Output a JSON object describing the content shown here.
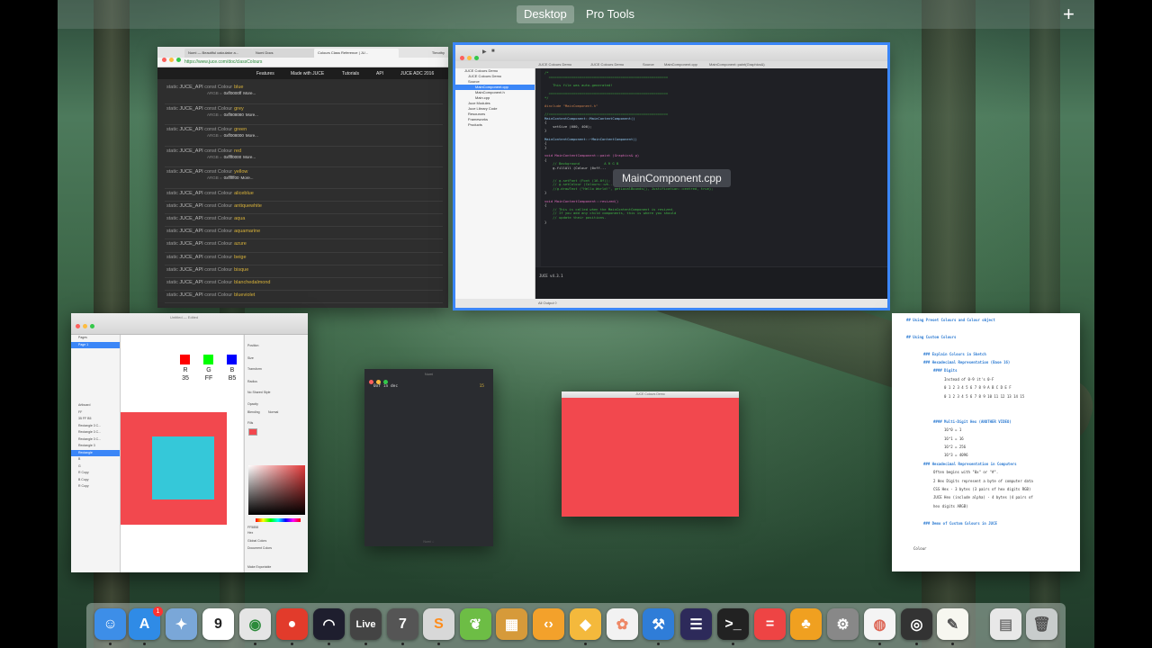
{
  "spaces_bar": {
    "tabs": [
      "Desktop",
      "Pro Tools"
    ],
    "active": "Desktop",
    "add_label": "+"
  },
  "browser": {
    "tabs": [
      "Numi — Beautiful calculator a...",
      "Numi Docs",
      "Colours Class Reference | JU..."
    ],
    "profile": "Timothy",
    "url": "https://www.juce.com/doc/classColours",
    "nav": [
      "Features",
      "Made with JUCE",
      "Tutorials",
      "API",
      "JUCE ADC 2016"
    ],
    "prefix": "static",
    "api": "JUCE_API",
    "type": "const Colour",
    "argb_label": "ARGB =",
    "more_label": "More...",
    "colours": [
      {
        "name": "blue",
        "argb": "0xff0000ff"
      },
      {
        "name": "grey",
        "argb": "0xff808080"
      },
      {
        "name": "green",
        "argb": "0xff008000"
      },
      {
        "name": "red",
        "argb": "0xffff0000"
      },
      {
        "name": "yellow",
        "argb": "0xffffff00"
      },
      {
        "name": "aliceblue"
      },
      {
        "name": "antiquewhite"
      },
      {
        "name": "aqua"
      },
      {
        "name": "aquamarine"
      },
      {
        "name": "azure"
      },
      {
        "name": "beige"
      },
      {
        "name": "bisque"
      },
      {
        "name": "blanchedalmond"
      },
      {
        "name": "blueviolet"
      }
    ]
  },
  "xcode": {
    "tabs": [
      "JUCE Colours Demo",
      "JUCE Colours Demo",
      "Source",
      "MainComponent.cpp",
      "MainComponent::paint(Graphics&)"
    ],
    "navigator": [
      "JUCE Colours Demo",
      "JUCE Colours Demo",
      "Source",
      "MainComponent.cpp",
      "MainComponent.h",
      "Main.cpp",
      "Juce Modules",
      "Juce Library Code",
      "Resources",
      "Frameworks",
      "Products"
    ],
    "code_lines": [
      {
        "t": "/*",
        "c": "cm"
      },
      {
        "t": "  ==========================================================",
        "c": "cm"
      },
      {
        "t": "",
        "c": ""
      },
      {
        "t": "    This file was auto-generated!",
        "c": "cm"
      },
      {
        "t": "",
        "c": ""
      },
      {
        "t": "  ==========================================================",
        "c": "cm"
      },
      {
        "t": "*/",
        "c": "cm"
      },
      {
        "t": "",
        "c": ""
      },
      {
        "t": "#include \"MainComponent.h\"",
        "c": "pp"
      },
      {
        "t": "",
        "c": ""
      },
      {
        "t": "//==========================================================",
        "c": "cm"
      },
      {
        "t": "MainContentComponent::MainContentComponent()",
        "c": "fn"
      },
      {
        "t": "{",
        "c": ""
      },
      {
        "t": "    setSize (600, 400);",
        "c": ""
      },
      {
        "t": "}",
        "c": ""
      },
      {
        "t": "",
        "c": ""
      },
      {
        "t": "MainContentComponent::~MainContentComponent()",
        "c": "fn"
      },
      {
        "t": "{",
        "c": ""
      },
      {
        "t": "}",
        "c": ""
      },
      {
        "t": "",
        "c": ""
      },
      {
        "t": "void MainContentComponent::paint (Graphics& g)",
        "c": "kw"
      },
      {
        "t": "{",
        "c": ""
      },
      {
        "t": "    // Background            A R G B",
        "c": "cm"
      },
      {
        "t": "    g.fillAll (Colour (0xff...",
        "c": ""
      },
      {
        "t": "",
        "c": ""
      },
      {
        "t": "",
        "c": ""
      },
      {
        "t": "    // g.setFont (Font (16.0f));",
        "c": "cm"
      },
      {
        "t": "    // g.setColour (Colours::wh...",
        "c": "cm"
      },
      {
        "t": "    //g.drawText (\"Hello World!\", getLocalBounds(), Justification::centred, true);",
        "c": "cm"
      },
      {
        "t": "}",
        "c": ""
      },
      {
        "t": "",
        "c": ""
      },
      {
        "t": "void MainContentComponent::resized()",
        "c": "kw"
      },
      {
        "t": "{",
        "c": ""
      },
      {
        "t": "    // This is called when the MainContentComponent is resized.",
        "c": "cm"
      },
      {
        "t": "    // If you add any child components, this is where you should",
        "c": "cm"
      },
      {
        "t": "    // update their positions.",
        "c": "cm"
      },
      {
        "t": "}",
        "c": ""
      }
    ],
    "console_text": "JUCE v4.3.1",
    "status": "All Output ◊"
  },
  "tooltip": "MainComponent.cpp",
  "sketch": {
    "title": "Untitled — Edited",
    "pages_header": "Pages",
    "pages": [
      "Page 1"
    ],
    "layers": [
      "Artboard",
      "FF",
      "35 FF B5",
      "Rectangle 3 C...",
      "Rectangle 3 C...",
      "Rectangle 3 C...",
      "Rectangle 3",
      "Rectangle",
      "B",
      "G",
      "R Copy",
      "B Copy",
      "R Copy"
    ],
    "selected_layer": "Rectangle",
    "rgb_labels": [
      {
        "ch": "R",
        "val": "35",
        "color": "#ff0000"
      },
      {
        "ch": "G",
        "val": "FF",
        "color": "#00ff00"
      },
      {
        "ch": "B",
        "val": "B5",
        "color": "#0000ff"
      }
    ],
    "outer_color": "#f2484e",
    "inner_color": "#35c8d9",
    "inspector": {
      "position_label": "Position",
      "size_label": "Size",
      "transform_label": "Transform",
      "radius_label": "Radius",
      "shared_style": "No Shared Style",
      "opacity_label": "Opacity",
      "blending_label": "Blending",
      "blending_value": "Normal",
      "fills_label": "Fills",
      "hex_label": "Hex",
      "hex_value": "FF5858",
      "global_colors": "Global Colors",
      "document_colors": "Document Colors",
      "make_exportable": "Make Exportable"
    }
  },
  "terminal": {
    "title": "Numi",
    "line": "0xf in dec",
    "result": "15",
    "bottom": "Numi ☆"
  },
  "demo_window": {
    "title": "JUCE Colours Demo",
    "color": "#f2484e"
  },
  "notes": {
    "lines": [
      {
        "t": "## Using Preset Colours and Colour object",
        "h": true
      },
      {
        "t": "",
        "h": false
      },
      {
        "t": "## Using Custom Colours",
        "h": true
      },
      {
        "t": "",
        "h": false
      },
      {
        "t": "### Explain Colours in Sketch",
        "h": true
      },
      {
        "t": "### Hexadecimal Representation (Base 16)",
        "h": true
      },
      {
        "t": "#### Digits",
        "h": true
      },
      {
        "t": "Instead of 0-9 it's 0-F",
        "h": false
      },
      {
        "t": "0 1 2 3 4 5 6 7 8 9 A B C D E F",
        "h": false
      },
      {
        "t": "0 1 2 3 4 5 6 7 8 9 10 11 12 13 14 15",
        "h": false
      },
      {
        "t": "",
        "h": false
      },
      {
        "t": "",
        "h": false
      },
      {
        "t": "#### Multi-Digit Hex (ANOTHER VIDEO)",
        "h": true
      },
      {
        "t": "16^0 = 1",
        "h": false
      },
      {
        "t": "16^1 = 16",
        "h": false
      },
      {
        "t": "16^2 = 256",
        "h": false
      },
      {
        "t": "16^3 = 4096",
        "h": false
      },
      {
        "t": "### Hexadecimal Representation in Computers",
        "h": true
      },
      {
        "t": "Often begins with \"0x\" or \"#\".",
        "h": false
      },
      {
        "t": "2 Hex Digits represent a byte of computer data",
        "h": false
      },
      {
        "t": "CSS Hex - 3 bytes (3 pairs of hex digits RGB)",
        "h": false
      },
      {
        "t": "JUCE Hex (include alpha) - 4 bytes (4 pairs of",
        "h": false
      },
      {
        "t": "hex digits ARGB)",
        "h": false
      },
      {
        "t": "",
        "h": false
      },
      {
        "t": "### Demo of Custom Colours in JUCE",
        "h": true
      },
      {
        "t": "",
        "h": false
      },
      {
        "t": "",
        "h": false
      },
      {
        "t": "Colour",
        "h": false
      }
    ]
  },
  "dock": {
    "items": [
      {
        "name": "finder-icon",
        "glyph": "☺",
        "bg": "#3d8ee8"
      },
      {
        "name": "app-store-icon",
        "glyph": "A",
        "bg": "#2f8be6"
      },
      {
        "name": "preview-icon",
        "glyph": "✦",
        "bg": "#7aa7d8"
      },
      {
        "name": "calendar-icon",
        "glyph": "9",
        "bg": "#ffffff",
        "fg": "#222"
      },
      {
        "name": "chrome-icon",
        "glyph": "◉",
        "bg": "#e5e5e5",
        "fg": "#2c8a3a"
      },
      {
        "name": "tomato-timer-icon",
        "glyph": "●",
        "bg": "#e23b2b"
      },
      {
        "name": "pro-tools-icon",
        "glyph": "◠",
        "bg": "#1e1e2e"
      },
      {
        "name": "ableton-live-icon",
        "glyph": "Live",
        "bg": "#444"
      },
      {
        "name": "numi-icon",
        "glyph": "7",
        "bg": "#555"
      },
      {
        "name": "sublime-text-icon",
        "glyph": "S",
        "bg": "#d8d8d8",
        "fg": "#ff8c1a"
      },
      {
        "name": "evernote-icon",
        "glyph": "❦",
        "bg": "#6dbd45"
      },
      {
        "name": "photo-slideshow-icon",
        "glyph": "▦",
        "bg": "#d69a3a"
      },
      {
        "name": "code-editor-icon",
        "glyph": "‹›",
        "bg": "#f3a12b"
      },
      {
        "name": "sketch-icon",
        "glyph": "◆",
        "bg": "#f4b93c"
      },
      {
        "name": "photos-icon",
        "glyph": "✿",
        "bg": "#f2f2f2",
        "fg": "#e86"
      },
      {
        "name": "xcode-icon",
        "glyph": "⚒",
        "bg": "#2f7dd8"
      },
      {
        "name": "eclipse-icon",
        "glyph": "☰",
        "bg": "#2d2a5a"
      },
      {
        "name": "terminal-icon",
        "glyph": ">_",
        "bg": "#222"
      },
      {
        "name": "calculator-app-icon",
        "glyph": "=",
        "bg": "#e44"
      },
      {
        "name": "butterfly-app-icon",
        "glyph": "♣",
        "bg": "#f0a020"
      },
      {
        "name": "system-preferences-icon",
        "glyph": "⚙",
        "bg": "#888"
      },
      {
        "name": "color-wheel-icon",
        "glyph": "◍",
        "bg": "#f4f4f4",
        "fg": "#d65"
      },
      {
        "name": "camera-app-icon",
        "glyph": "◎",
        "bg": "#333"
      },
      {
        "name": "textedit-icon",
        "glyph": "✎",
        "bg": "#f7f7f0",
        "fg": "#555"
      },
      {
        "name": "documents-folder-icon",
        "glyph": "▤",
        "bg": "#e8e8e8",
        "fg": "#777"
      },
      {
        "name": "trash-icon",
        "glyph": "🗑",
        "bg": "#c8cccc",
        "fg": "#555"
      }
    ],
    "badge": "1"
  }
}
